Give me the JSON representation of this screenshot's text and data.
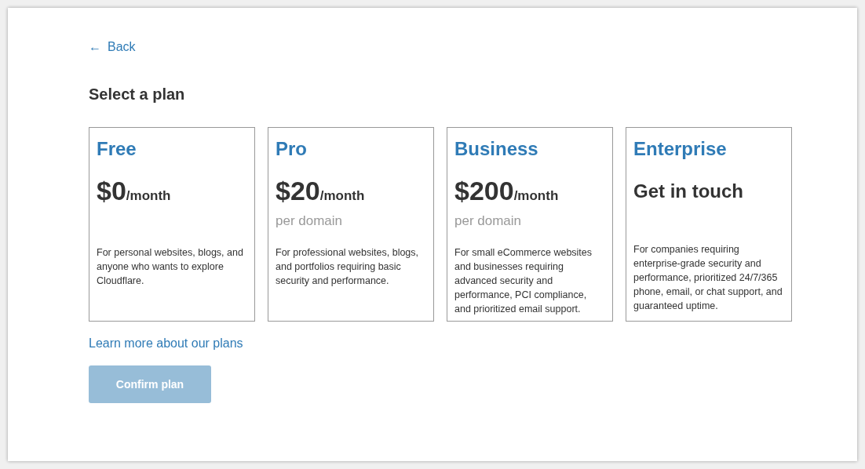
{
  "back_link": {
    "icon": "←",
    "label": "Back"
  },
  "title": "Select a plan",
  "plans": [
    {
      "kind": "price",
      "name": "Free",
      "price": "$0",
      "period": "/month",
      "description": "For personal websites, blogs, and anyone who wants to explore Cloudflare."
    },
    {
      "kind": "price",
      "name": "Pro",
      "price": "$20",
      "period": "/month",
      "unit": "per domain",
      "description": "For professional websites, blogs, and portfolios requiring basic security and performance."
    },
    {
      "kind": "price",
      "name": "Business",
      "price": "$200",
      "period": "/month",
      "unit": "per domain",
      "description": "For small eCommerce websites and businesses requiring advanced security and performance, PCI compliance, and prioritized email support."
    },
    {
      "kind": "contact",
      "name": "Enterprise",
      "price": "Get in touch",
      "description": "For companies requiring enterprise-grade security and performance, prioritized 24/7/365 phone, email, or chat support, and guaranteed uptime."
    }
  ],
  "learn_more_link": "Learn more about our plans",
  "confirm_button": {
    "label": "Confirm plan",
    "disabled": true
  }
}
